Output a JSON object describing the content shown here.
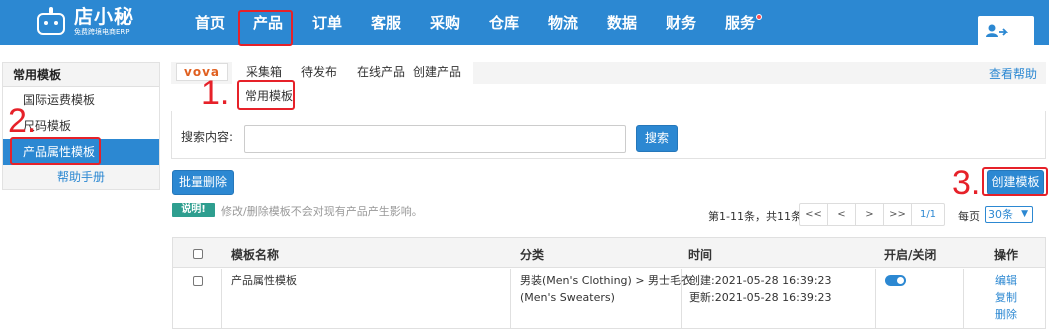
{
  "brand": {
    "name": "店小秘",
    "tagline": "免费跨境电商ERP"
  },
  "nav": {
    "items": [
      "首页",
      "产品",
      "订单",
      "客服",
      "采购",
      "仓库",
      "物流",
      "数据",
      "财务",
      "服务"
    ],
    "active": "产品"
  },
  "sidebar": {
    "title": "常用模板",
    "items": [
      "国际运费模板",
      "尺码模板",
      "产品属性模板"
    ],
    "active": "产品属性模板",
    "help": "帮助手册"
  },
  "tabs": {
    "platform": "vova",
    "items": [
      "采集箱",
      "待发布",
      "在线产品",
      "创建产品"
    ],
    "subtab": "常用模板",
    "view_help": "查看帮助"
  },
  "annotations": {
    "one": "1.",
    "two": "2.",
    "three": "3."
  },
  "search": {
    "label": "搜索内容:",
    "value": "",
    "button": "搜索"
  },
  "actions": {
    "bulk_delete": "批量删除",
    "create_template": "创建模板"
  },
  "note": {
    "badge": "说明!",
    "text": "修改/删除模板不会对现有产品产生影响。"
  },
  "pagination": {
    "summary": "第1-11条，共11条",
    "buttons": [
      "<<",
      "<",
      ">",
      ">>"
    ],
    "page": "1/1",
    "per_page_label": "每页",
    "per_page_value": "30条"
  },
  "table": {
    "headers": [
      "模板名称",
      "分类",
      "时间",
      "开启/关闭",
      "操作"
    ],
    "rows": [
      {
        "name": "产品属性模板",
        "category_line1": "男装(Men's Clothing) > 男士毛衣",
        "category_line2": "(Men's Sweaters)",
        "created": "创建:2021-05-28 16:39:23",
        "updated": "更新:2021-05-28 16:39:23",
        "enabled": true,
        "actions": [
          "编辑",
          "复制",
          "删除"
        ]
      }
    ]
  },
  "colors": {
    "primary": "#2c88d2",
    "annotation": "#e62129",
    "note": "#2e9e8f"
  }
}
